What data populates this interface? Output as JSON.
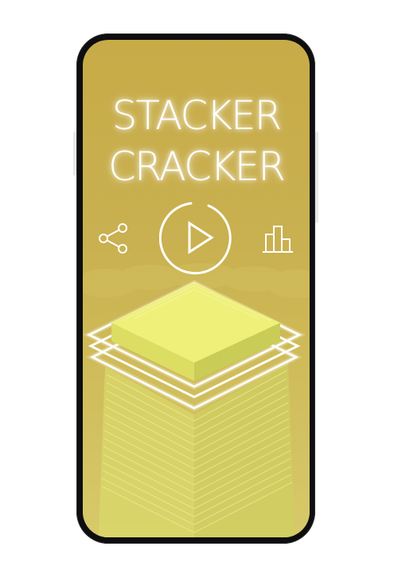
{
  "game": {
    "title_line1": "STACKER",
    "title_line2": "CRACKER"
  },
  "controls": {
    "share_icon": "share-icon",
    "play_icon": "play-icon",
    "leaderboard_icon": "leaderboard-icon"
  },
  "colors": {
    "background": "#c9b050",
    "block_top": "#eef07a",
    "block_side_left": "#d9da62",
    "block_side_right": "#c8cb55",
    "glow": "#ffffff"
  }
}
